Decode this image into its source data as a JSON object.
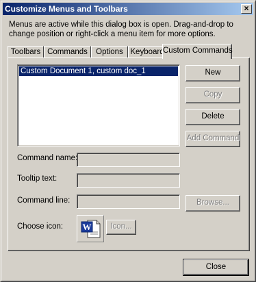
{
  "window": {
    "title": "Customize Menus and Toolbars",
    "close_glyph": "×"
  },
  "info_text": "Menus are active while this dialog box is open. Drag-and-drop to change position or right-click a menu item for more options.",
  "tabs": [
    {
      "label": "Toolbars",
      "active": false
    },
    {
      "label": "Commands",
      "active": false
    },
    {
      "label": "Options",
      "active": false
    },
    {
      "label": "Keyboard",
      "active": false
    },
    {
      "label": "Custom Commands",
      "active": true
    }
  ],
  "command_list": {
    "items": [
      "Custom Document 1, custom doc_1"
    ],
    "selected_index": 0
  },
  "buttons": {
    "new": "New",
    "copy": "Copy",
    "delete": "Delete",
    "add_command": "Add Command",
    "browse": "Browse...",
    "icon": "Icon...",
    "close": "Close"
  },
  "fields": {
    "command_name": {
      "label": "Command name:",
      "value": ""
    },
    "tooltip_text": {
      "label": "Tooltip text:",
      "value": ""
    },
    "command_line": {
      "label": "Command line:",
      "value": ""
    }
  },
  "choose_icon": {
    "label": "Choose icon:",
    "icon": "word-document-icon",
    "icon_letter": "W"
  },
  "colors": {
    "titlebar_start": "#0a246a",
    "titlebar_end": "#a6caf0",
    "selection": "#0a246a",
    "face": "#d4d0c8"
  }
}
